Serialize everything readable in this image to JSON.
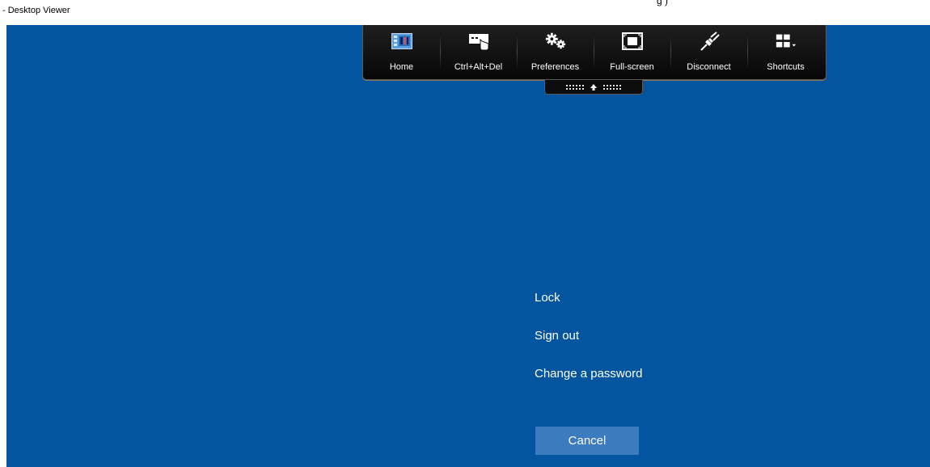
{
  "window": {
    "title": "- Desktop Viewer",
    "partial_title": "g ) "
  },
  "toolbar": {
    "buttons": [
      {
        "id": "home",
        "label": "Home",
        "icon": "home-thumbnail-icon"
      },
      {
        "id": "ctrl-alt-del",
        "label": "Ctrl+Alt+Del",
        "icon": "keyboard-touch-icon"
      },
      {
        "id": "preferences",
        "label": "Preferences",
        "icon": "gears-icon"
      },
      {
        "id": "full-screen",
        "label": "Full-screen",
        "icon": "fullscreen-icon"
      },
      {
        "id": "disconnect",
        "label": "Disconnect",
        "icon": "plug-icon"
      },
      {
        "id": "shortcuts",
        "label": "Shortcuts",
        "icon": "grid-dropdown-icon"
      }
    ],
    "handle_icon": "arrow-up-icon"
  },
  "security_menu": {
    "lock": "Lock",
    "sign_out": "Sign out",
    "change_password": "Change a password",
    "cancel": "Cancel"
  },
  "colors": {
    "desktop": "#0355a0",
    "toolbar": "#0c0c0c",
    "cancel_button": "#3c7bbd"
  }
}
